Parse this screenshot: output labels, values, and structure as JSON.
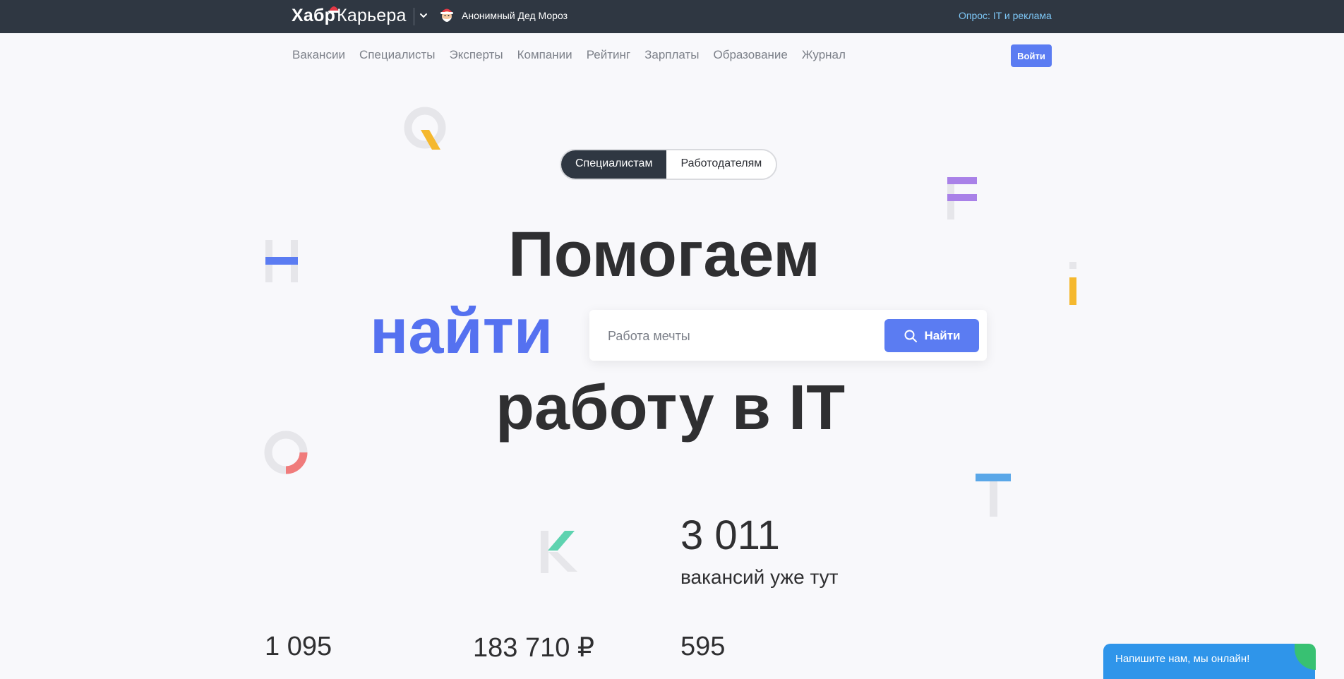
{
  "header": {
    "logo_habr": "Хабр",
    "logo_kariera": "Карьера",
    "anon_user": "Анонимный Дед Мороз",
    "survey_link": "Опрос: IT и реклама"
  },
  "nav": {
    "items": [
      "Вакансии",
      "Специалисты",
      "Эксперты",
      "Компании",
      "Рейтинг",
      "Зарплаты",
      "Образование",
      "Журнал"
    ],
    "login_label": "Войти"
  },
  "audience_toggle": {
    "active": "Специалистам",
    "inactive": "Работодателям"
  },
  "hero": {
    "line1": "Помогаем",
    "line2": "найти",
    "line3": "работу в IT"
  },
  "search": {
    "placeholder": "Работа мечты",
    "button_label": "Найти"
  },
  "stats": {
    "vacancies_count": "3 011",
    "vacancies_caption": "вакансий уже тут",
    "stat1": "1 095",
    "stat2": "183 710 ₽",
    "stat3": "595"
  },
  "chat": {
    "label": "Напишите нам, мы онлайн!"
  },
  "colors": {
    "topbar": "#2f3742",
    "accent": "#5b7cf2",
    "accent_text": "#5571f0",
    "survey_link": "#7dc6f5",
    "chat": "#2f95ea"
  },
  "icons": [
    "hat-icon",
    "chevron-down-icon",
    "santa-avatar-icon",
    "search-icon"
  ]
}
